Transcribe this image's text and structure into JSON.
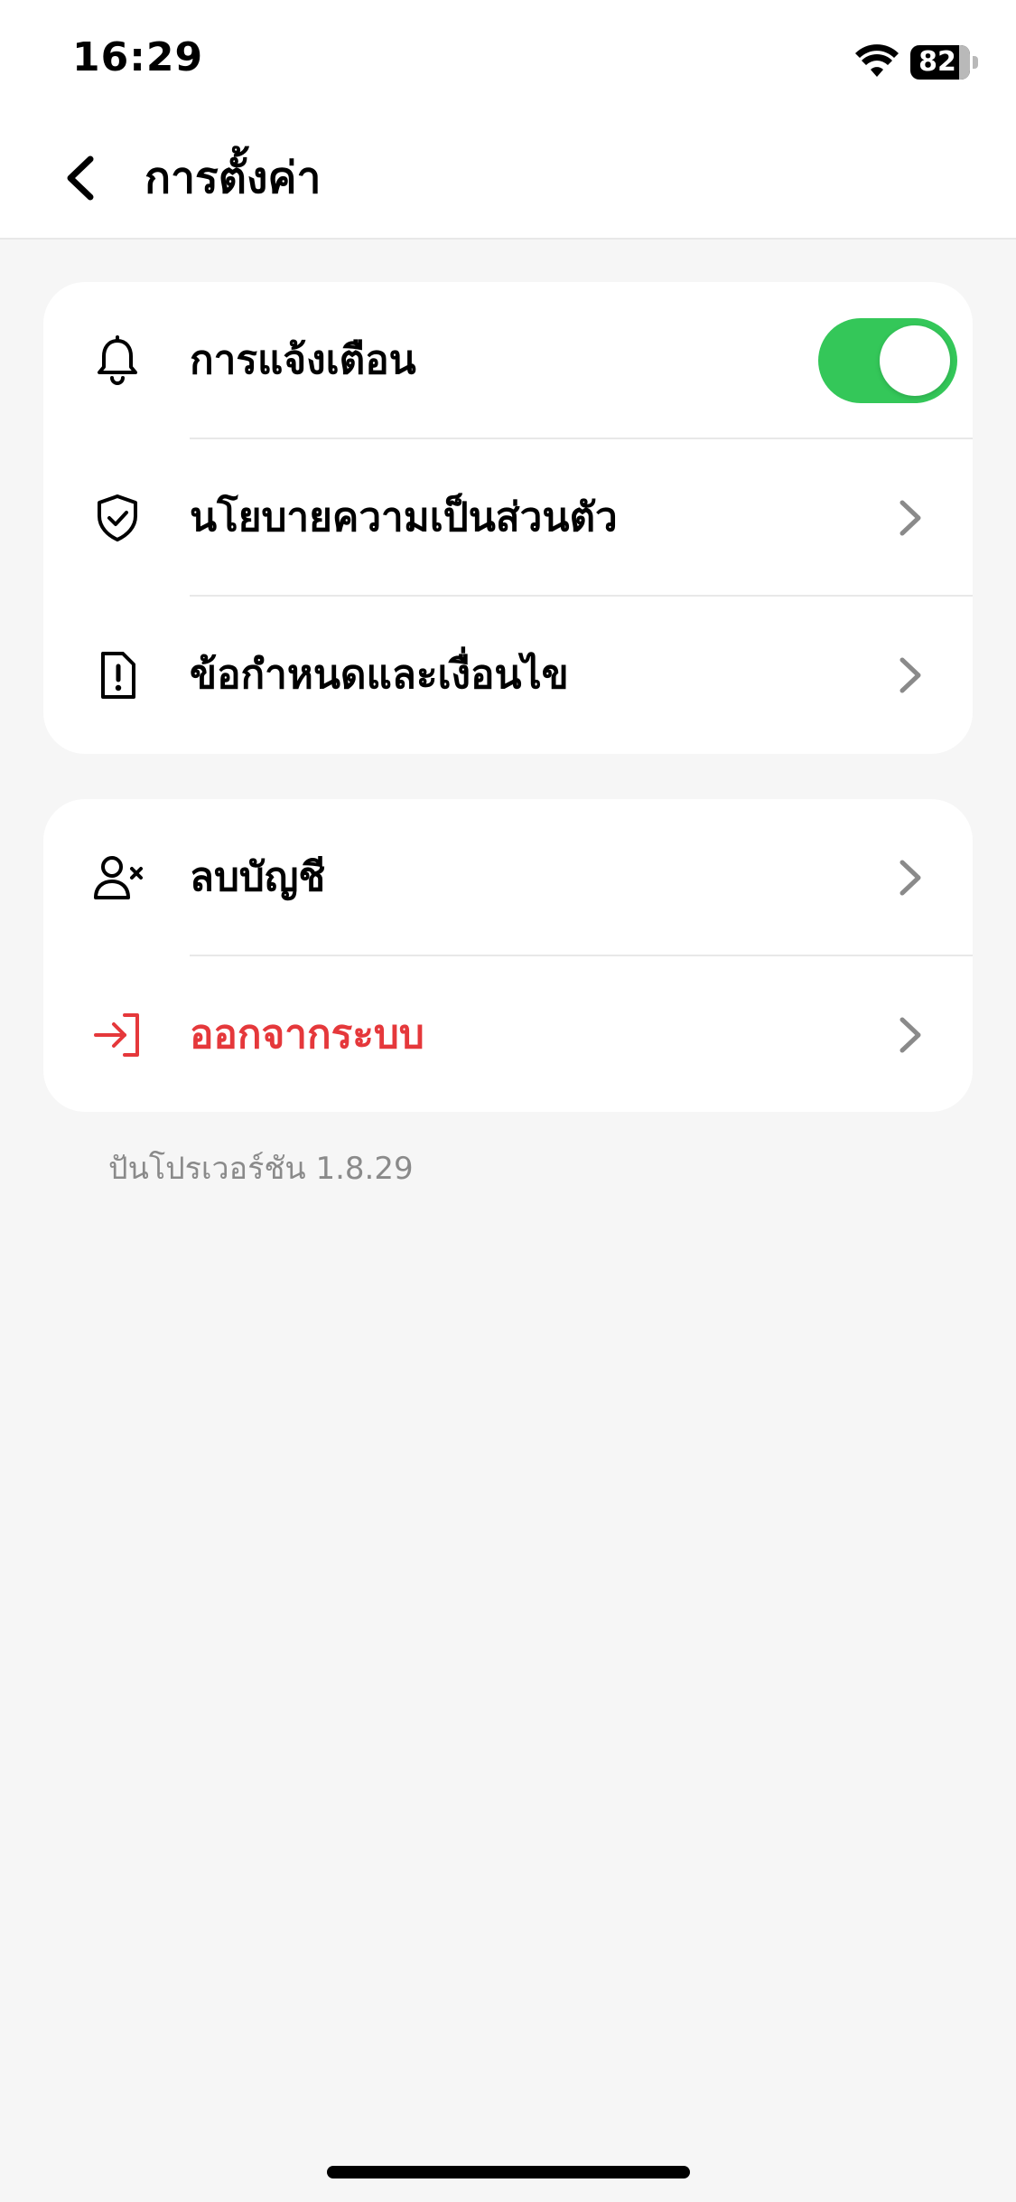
{
  "status_bar": {
    "time": "16:29",
    "battery": "82",
    "battery_level_percent": 82
  },
  "header": {
    "back_icon": "chevron-left-icon",
    "title": "การตั้งค่า"
  },
  "sections": [
    {
      "items": [
        {
          "label": "การแจ้งเตือน",
          "icon": "bell-icon",
          "control": "toggle",
          "toggle_on": true
        },
        {
          "label": "นโยบายความเป็นส่วนตัว",
          "icon": "shield-check-icon",
          "control": "chevron"
        },
        {
          "label": "ข้อกำหนดและเงื่อนไข",
          "icon": "document-alert-icon",
          "control": "chevron"
        }
      ]
    },
    {
      "items": [
        {
          "label": "ลบบัญชี",
          "icon": "user-remove-icon",
          "control": "chevron"
        },
        {
          "label": "ออกจากระบบ",
          "icon": "logout-icon",
          "control": "chevron",
          "style": "danger"
        }
      ]
    }
  ],
  "version_text": "ปันโปรเวอร์ชัน 1.8.29",
  "colors": {
    "accent_toggle": "#34c759",
    "danger": "#e5383b",
    "background": "#f6f6f6",
    "muted_text": "#8a8a8a"
  }
}
